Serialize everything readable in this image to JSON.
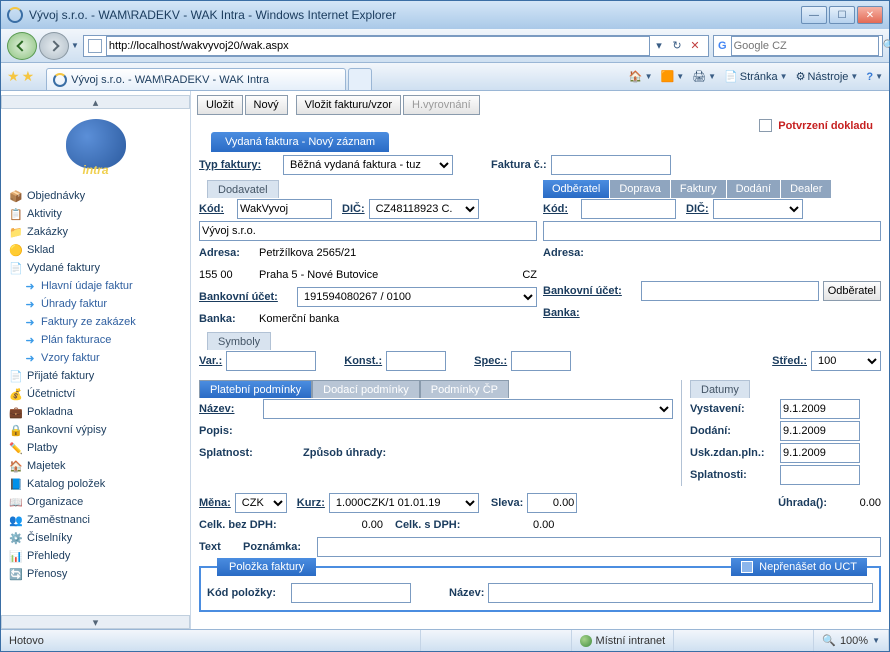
{
  "window": {
    "title": "Vývoj s.r.o. - WAM\\RADEKV - WAK Intra - Windows Internet Explorer",
    "tab_title": "Vývoj s.r.o. - WAM\\RADEKV - WAK Intra"
  },
  "address": {
    "url": "http://localhost/wakvyvoj20/wak.aspx"
  },
  "search": {
    "placeholder": "Google CZ"
  },
  "ie_tools": {
    "page": "Stránka",
    "tools": "Nástroje"
  },
  "sidebar": {
    "items": [
      {
        "ic": "📦",
        "label": "Objednávky"
      },
      {
        "ic": "📋",
        "label": "Aktivity"
      },
      {
        "ic": "📁",
        "label": "Zakázky"
      },
      {
        "ic": "🟡",
        "label": "Sklad"
      },
      {
        "ic": "📄",
        "label": "Vydané faktury"
      },
      {
        "ic": "➜",
        "label": "Hlavní údaje faktur",
        "sub": true
      },
      {
        "ic": "➜",
        "label": "Úhrady faktur",
        "sub": true
      },
      {
        "ic": "➜",
        "label": "Faktury ze zakázek",
        "sub": true
      },
      {
        "ic": "➜",
        "label": "Plán fakturace",
        "sub": true
      },
      {
        "ic": "➜",
        "label": "Vzory faktur",
        "sub": true
      },
      {
        "ic": "📄",
        "label": "Přijaté faktury"
      },
      {
        "ic": "💰",
        "label": "Účetnictví"
      },
      {
        "ic": "💼",
        "label": "Pokladna"
      },
      {
        "ic": "🔒",
        "label": "Bankovní výpisy"
      },
      {
        "ic": "✏️",
        "label": "Platby"
      },
      {
        "ic": "🏠",
        "label": "Majetek"
      },
      {
        "ic": "📘",
        "label": "Katalog položek"
      },
      {
        "ic": "📖",
        "label": "Organizace"
      },
      {
        "ic": "👥",
        "label": "Zaměstnanci"
      },
      {
        "ic": "⚙️",
        "label": "Číselníky"
      },
      {
        "ic": "📊",
        "label": "Přehledy"
      },
      {
        "ic": "🔄",
        "label": "Přenosy"
      }
    ]
  },
  "actions": {
    "save": "Uložit",
    "new": "Nový",
    "insert": "Vložit fakturu/vzor",
    "hvyr": "H.vyrovnání"
  },
  "confirm": {
    "label": "Potvrzení dokladu"
  },
  "section": {
    "title": "Vydaná faktura - Nový záznam"
  },
  "header_row": {
    "typ_label": "Typ faktury:",
    "typ_value": "Běžná vydaná faktura - tuz",
    "faktura_label": "Faktura č.:",
    "faktura_value": ""
  },
  "dodavatel": {
    "legend": "Dodavatel",
    "kod_label": "Kód:",
    "kod_value": "WakVyvoj",
    "dic_label": "DIČ:",
    "dic_value": "CZ48118923 C.",
    "name": "Vývoj s.r.o.",
    "adresa_label": "Adresa:",
    "adresa_value": "Petržílkova 2565/21",
    "psc": "155 00",
    "mesto": "Praha 5 - Nové Butovice",
    "zeme": "CZ",
    "bu_label": "Bankovní účet:",
    "bu_value": "191594080267 / 0100",
    "banka_label": "Banka:",
    "banka_value": "Komerční banka"
  },
  "odberatel": {
    "tabs": [
      "Odběratel",
      "Doprava",
      "Faktury",
      "Dodání",
      "Dealer"
    ],
    "kod_label": "Kód:",
    "kod_value": "",
    "dic_label": "DIČ:",
    "dic_value": "",
    "name": "",
    "adresa_label": "Adresa:",
    "bu_label": "Bankovní účet:",
    "bu_value": "",
    "banka_label": "Banka:",
    "btn": "Odběratel"
  },
  "symboly": {
    "legend": "Symboly",
    "var_label": "Var.:",
    "var_value": "",
    "konst_label": "Konst.:",
    "konst_value": "",
    "spec_label": "Spec.:",
    "spec_value": "",
    "stred_label": "Střed.:",
    "stred_value": "100"
  },
  "platpod": {
    "tabs": [
      "Platební podmínky",
      "Dodací podmínky",
      "Podmínky ČP"
    ],
    "nazev_label": "Název:",
    "nazev_value": "",
    "popis_label": "Popis:",
    "splatnost_label": "Splatnost:",
    "zpusob_label": "Způsob úhrady:"
  },
  "datumy": {
    "legend": "Datumy",
    "vystaveni_label": "Vystavení:",
    "vystaveni_value": "9.1.2009",
    "dodani_label": "Dodání:",
    "dodani_value": "9.1.2009",
    "usk_label": "Usk.zdan.pln.:",
    "usk_value": "9.1.2009",
    "splatnosti_label": "Splatnosti:",
    "splatnosti_value": ""
  },
  "money": {
    "mena_label": "Měna:",
    "mena_value": "CZK",
    "kurz_label": "Kurz:",
    "kurz_value": "1.000CZK/1   01.01.19",
    "sleva_label": "Sleva:",
    "sleva_value": "0.00",
    "bezdph_label": "Celk. bez DPH:",
    "bezdph_value": "0.00",
    "sdph_label": "Celk. s DPH:",
    "sdph_value": "0.00",
    "uhrada_label": "Úhrada():",
    "uhrada_value": "0.00",
    "text_label": "Text",
    "pozn_label": "Poznámka:",
    "pozn_value": ""
  },
  "polozka": {
    "title": "Položka faktury",
    "flag": "Nepřenášet do UCT",
    "kod_label": "Kód položky:",
    "kod_value": "",
    "nazev_label": "Název:",
    "nazev_value": ""
  },
  "status": {
    "ready": "Hotovo",
    "zone": "Místní intranet",
    "zoom": "100%"
  }
}
